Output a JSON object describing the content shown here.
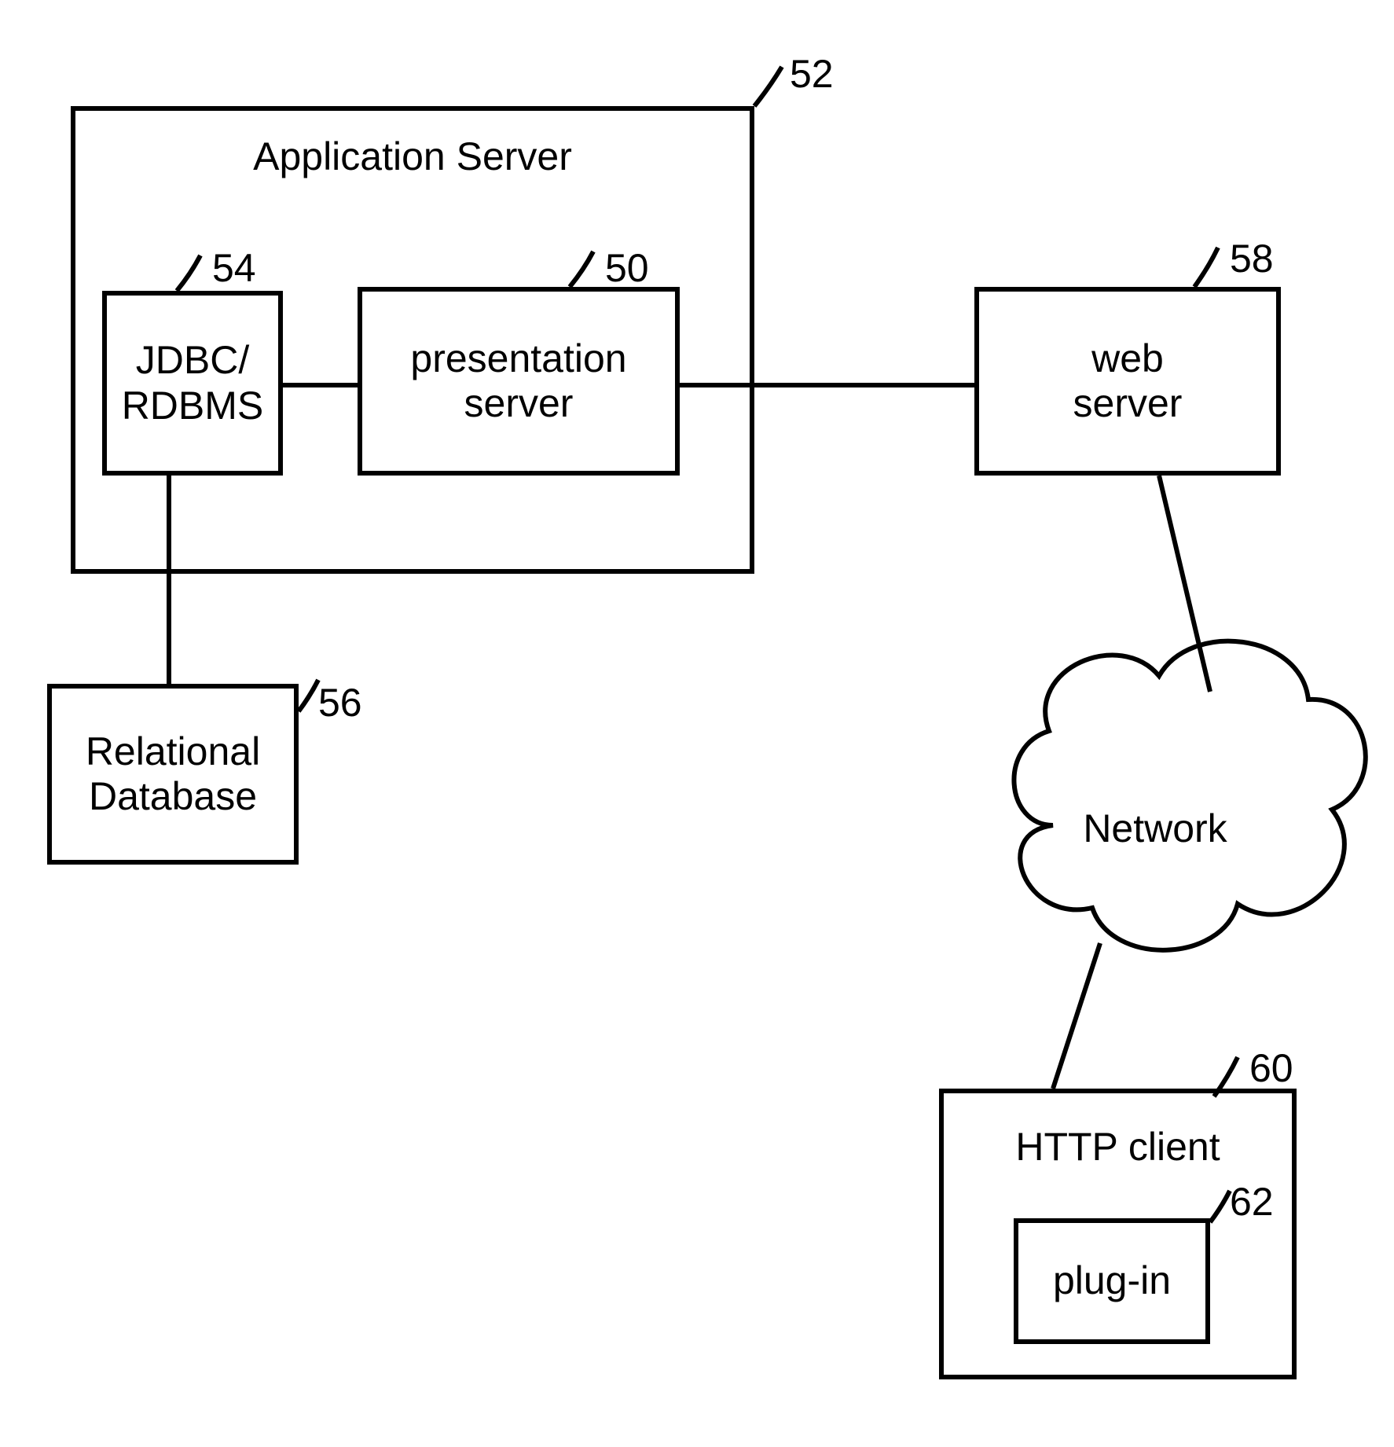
{
  "nodes": {
    "app_server": {
      "label": "Application Server",
      "ref": "52"
    },
    "jdbc": {
      "label": "JDBC/\nRDBMS",
      "ref": "54"
    },
    "pres": {
      "label": "presentation\nserver",
      "ref": "50"
    },
    "reldb": {
      "label": "Relational\nDatabase",
      "ref": "56"
    },
    "web": {
      "label": "web\nserver",
      "ref": "58"
    },
    "network": {
      "label": "Network"
    },
    "http": {
      "label": "HTTP client",
      "ref": "60"
    },
    "plugin": {
      "label": "plug-in",
      "ref": "62"
    }
  }
}
